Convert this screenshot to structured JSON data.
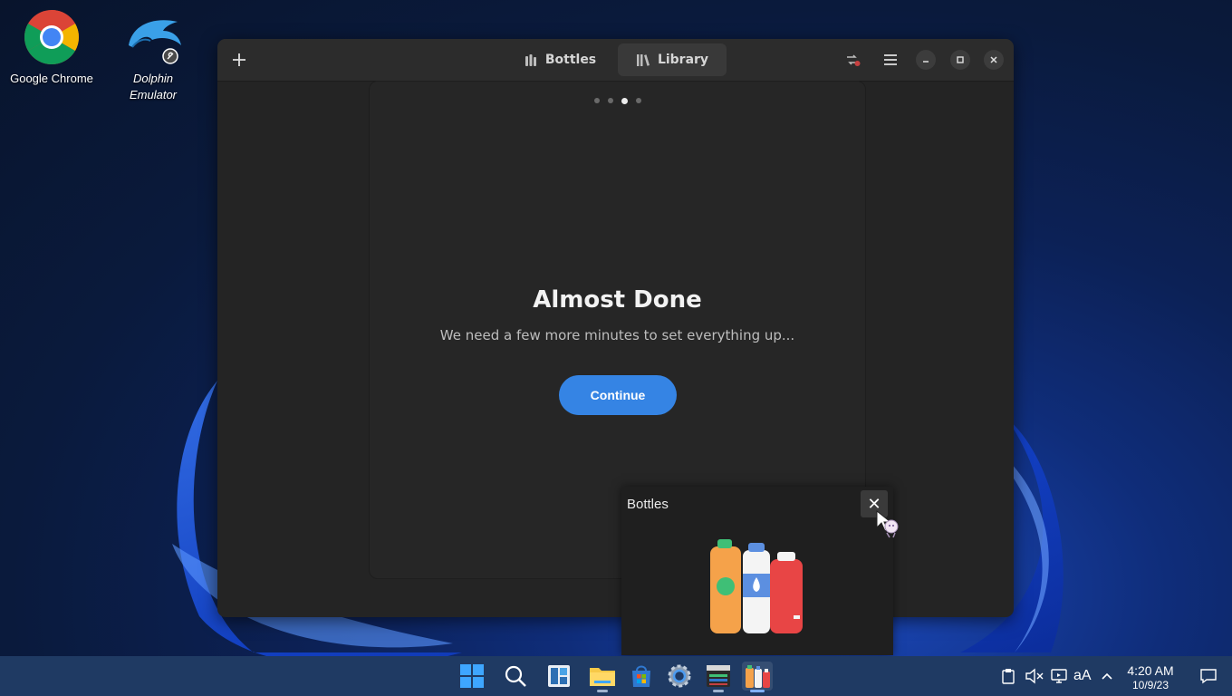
{
  "desktop": {
    "icons": [
      {
        "label": "Google Chrome"
      },
      {
        "label": "Dolphin Emulator"
      }
    ]
  },
  "window": {
    "tabs": [
      {
        "label": "Bottles",
        "icon": "bottles-icon"
      },
      {
        "label": "Library",
        "icon": "library-icon"
      }
    ],
    "active_tab": "Library",
    "onboarding": {
      "pages": 4,
      "current_page": 3,
      "title": "Almost Done",
      "subtitle": "We need a few more minutes to set everything up...",
      "button": "Continue"
    }
  },
  "preview": {
    "title": "Bottles",
    "close": "✕"
  },
  "taskbar": {
    "apps": [
      "start",
      "search",
      "widgets",
      "file-explorer",
      "store",
      "settings",
      "terminal",
      "bottles"
    ],
    "time": "4:20 AM",
    "date": "10/9/23",
    "lang": "aA"
  },
  "colors": {
    "accent": "#3584e4",
    "window_bg": "#242424",
    "header_bg": "#2c2c2c",
    "taskbar": "#1f3a63"
  }
}
